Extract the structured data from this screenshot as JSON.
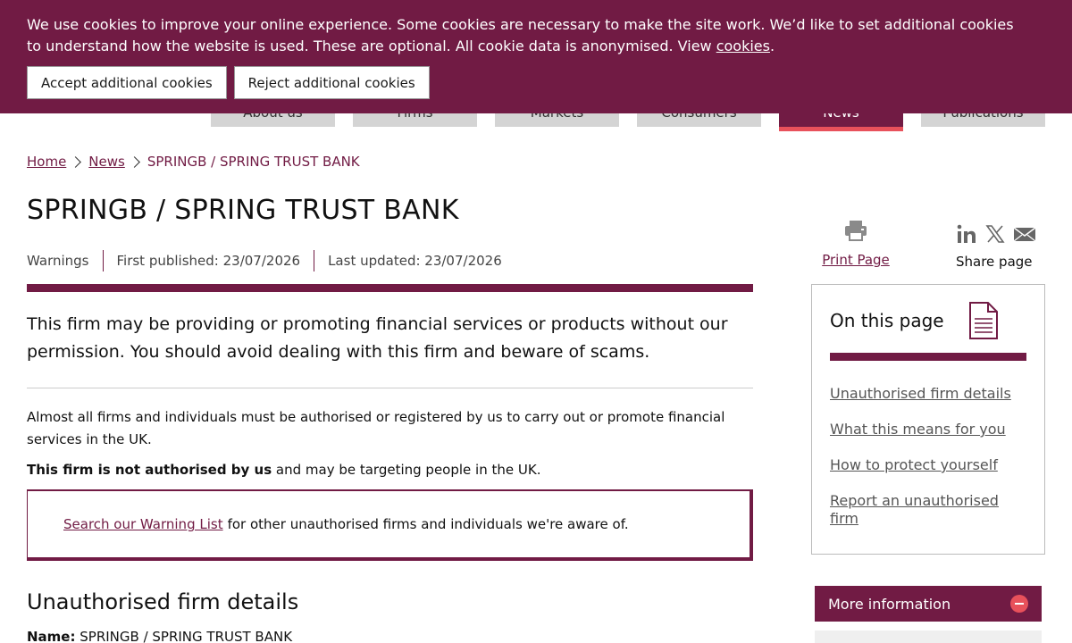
{
  "cookie": {
    "text": "We use cookies to improve your online experience. Some cookies are necessary to make the site work. We’d like to set additional cookies to understand how the website is used. These are optional. All cookie data is anonymised. View ",
    "link": "cookies",
    "after": ".",
    "accept": "Accept additional cookies",
    "reject": "Reject additional cookies"
  },
  "nav": {
    "tabs": [
      "About us",
      "Firms",
      "Markets",
      "Consumers",
      "News",
      "Publications"
    ],
    "active": "News"
  },
  "breadcrumb": {
    "home": "Home",
    "news": "News",
    "current": "SPRINGB / SPRING TRUST BANK"
  },
  "page": {
    "title": "SPRINGB / SPRING TRUST BANK",
    "type": "Warnings",
    "first_published": "First published: 23/07/2026",
    "last_updated": "Last updated: 23/07/2026",
    "lead": "This firm may be providing or promoting financial services or products without our permission. You should avoid dealing with this firm and beware of scams.",
    "para1": "Almost all firms and individuals must be authorised or registered by us to carry out or promote financial services in the UK.",
    "para2_bold": "This firm is not authorised by us",
    "para2_rest": " and may be targeting people in the UK.",
    "callout_link": "Search our Warning List",
    "callout_rest": "for other unauthorised firms and individuals we're aware of.",
    "section_title": "Unauthorised firm details",
    "name_label": "Name:",
    "name_value": " SPRINGB / SPRING TRUST BANK"
  },
  "sidebar": {
    "print_label": "Print Page",
    "share_label": "Share page",
    "on_this_page": "On this page",
    "links": [
      "Unauthorised firm details",
      "What this means for you",
      "How to protect yourself",
      "Report an unauthorised firm"
    ],
    "more_info": "More information"
  },
  "colors": {
    "brand": "#711b44",
    "accent": "#e8515b"
  }
}
